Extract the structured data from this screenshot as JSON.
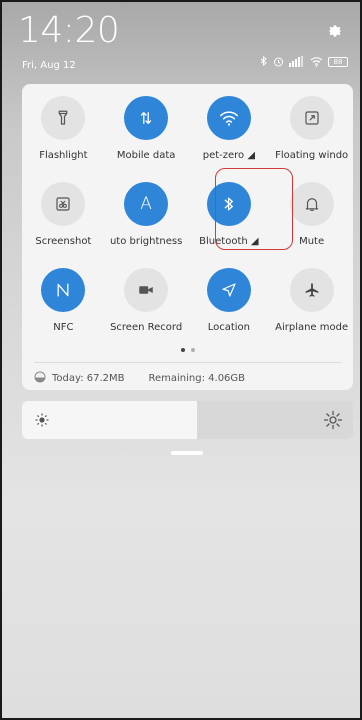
{
  "status_bar": {
    "time": "14:20",
    "date": "Fri, Aug 12",
    "battery": "88"
  },
  "tiles": [
    {
      "label": "Flashlight",
      "icon": "flashlight-icon",
      "on": false
    },
    {
      "label": "Mobile data",
      "icon": "mobile-data-icon",
      "on": true
    },
    {
      "label": "pet-zero ◢",
      "icon": "wifi-icon",
      "on": true
    },
    {
      "label": "Floating windo",
      "icon": "floating-window-icon",
      "on": false
    },
    {
      "label": "Screenshot",
      "icon": "screenshot-icon",
      "on": false
    },
    {
      "label": "uto brightness",
      "icon": "auto-brightness-icon",
      "on": true
    },
    {
      "label": "Bluetooth ◢",
      "icon": "bluetooth-icon",
      "on": true
    },
    {
      "label": "Mute",
      "icon": "bell-icon",
      "on": false
    },
    {
      "label": "NFC",
      "icon": "nfc-icon",
      "on": true
    },
    {
      "label": "Screen Record",
      "icon": "video-camera-icon",
      "on": false
    },
    {
      "label": "Location",
      "icon": "location-icon",
      "on": true
    },
    {
      "label": "Airplane mode",
      "icon": "airplane-icon",
      "on": false
    }
  ],
  "auto_brightness_glyph": "A",
  "usage": {
    "today": "Today: 67.2MB",
    "remaining": "Remaining: 4.06GB"
  },
  "brightness_level": 0.53,
  "colors": {
    "accent": "#2f86d8",
    "highlight": "#d33a3a"
  }
}
